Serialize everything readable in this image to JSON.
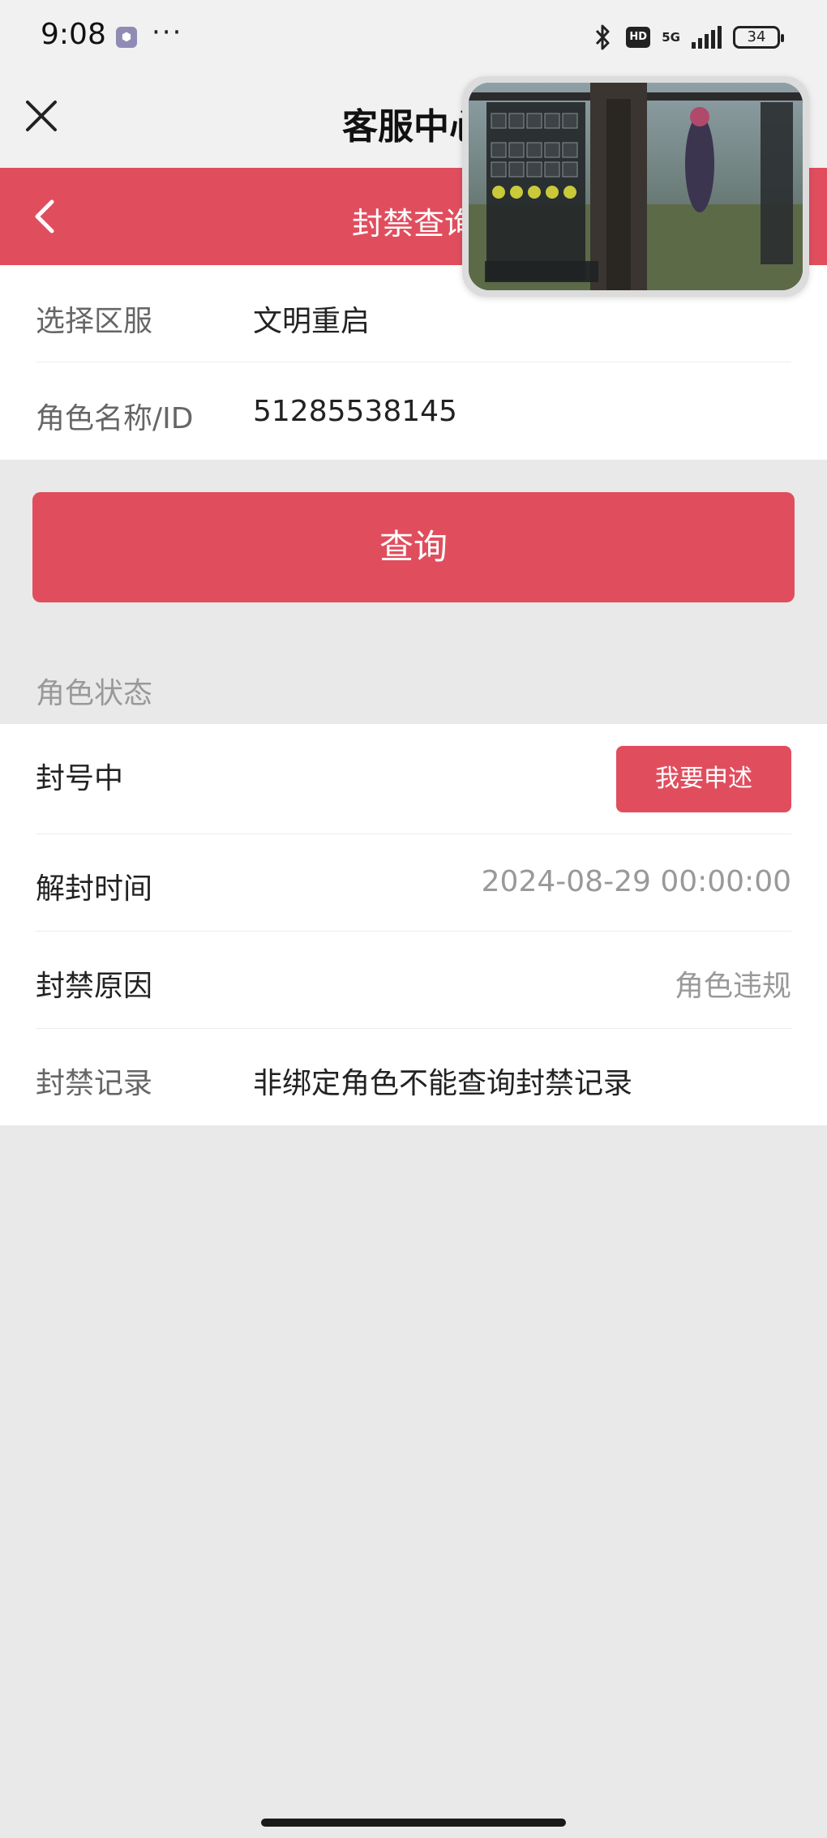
{
  "status_bar": {
    "time": "9:08",
    "more": "···",
    "hd": "HD",
    "network": "5G",
    "battery": "34",
    "icons": [
      "app-notification-icon",
      "bluetooth-icon",
      "hd-icon",
      "signal-icon",
      "battery-icon"
    ]
  },
  "header": {
    "title": "客服中心",
    "close_icon": "close-icon"
  },
  "page": {
    "title": "封禁查询",
    "back_icon": "chevron-left-icon",
    "accent_color": "#e04e5e"
  },
  "form": {
    "server_label": "选择区服",
    "server_value": "文明重启",
    "role_label": "角色名称/ID",
    "role_value": "51285538145"
  },
  "query_button": "查询",
  "role_status": {
    "section_title": "角色状态",
    "status": "封号中",
    "appeal_button": "我要申述",
    "unban_label": "解封时间",
    "unban_time": "2024-08-29 00:00:00",
    "reason_label": "封禁原因",
    "reason_value": "角色违规",
    "record_label": "封禁记录",
    "record_value": "非绑定角色不能查询封禁记录"
  }
}
